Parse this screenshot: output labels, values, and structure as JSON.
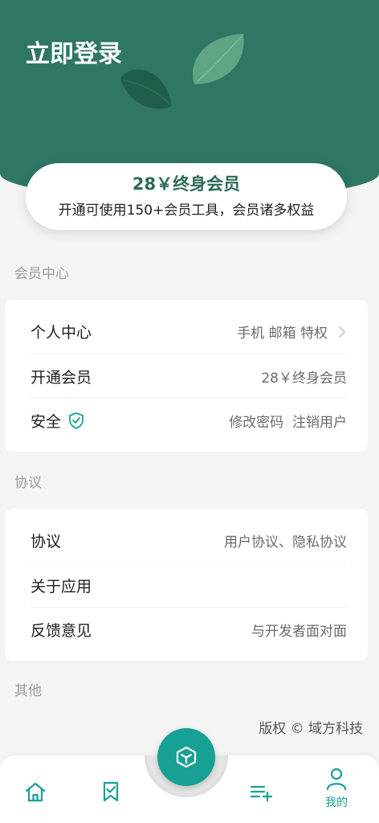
{
  "header": {
    "title": "立即登录"
  },
  "vip_banner": {
    "title": "28￥终身会员",
    "subtitle": "开通可使用150+会员工具，会员诸多权益"
  },
  "sections": [
    {
      "label": "会员中心",
      "items": [
        {
          "label": "个人中心",
          "value": "手机 邮箱 特权",
          "trailing_icon": "chevron-right-icon"
        },
        {
          "label": "开通会员",
          "value": "28￥终身会员"
        },
        {
          "label": "安全",
          "label_icon": "shield-check-icon",
          "value": "修改密码  注销用户"
        }
      ]
    },
    {
      "label": "协议",
      "items": [
        {
          "label": "协议",
          "value": "用户协议、隐私协议"
        },
        {
          "label": "关于应用"
        },
        {
          "label": "反馈意见",
          "value": "与开发者面对面"
        }
      ]
    },
    {
      "label": "其他"
    }
  ],
  "copyright": "版权 © 域方科技",
  "bottom_nav": {
    "items": [
      {
        "icon": "home-icon"
      },
      {
        "icon": "bookmark-check-icon"
      },
      {
        "icon": "playlist-add-icon"
      },
      {
        "icon": "person-icon",
        "label": "我的",
        "active": true
      }
    ],
    "center_button": {
      "icon": "cube-icon"
    }
  },
  "colors": {
    "header_bg": "#2f7665",
    "accent": "#17a094",
    "vip_title": "#2b6b58",
    "page_bg": "#f4f4f4"
  }
}
